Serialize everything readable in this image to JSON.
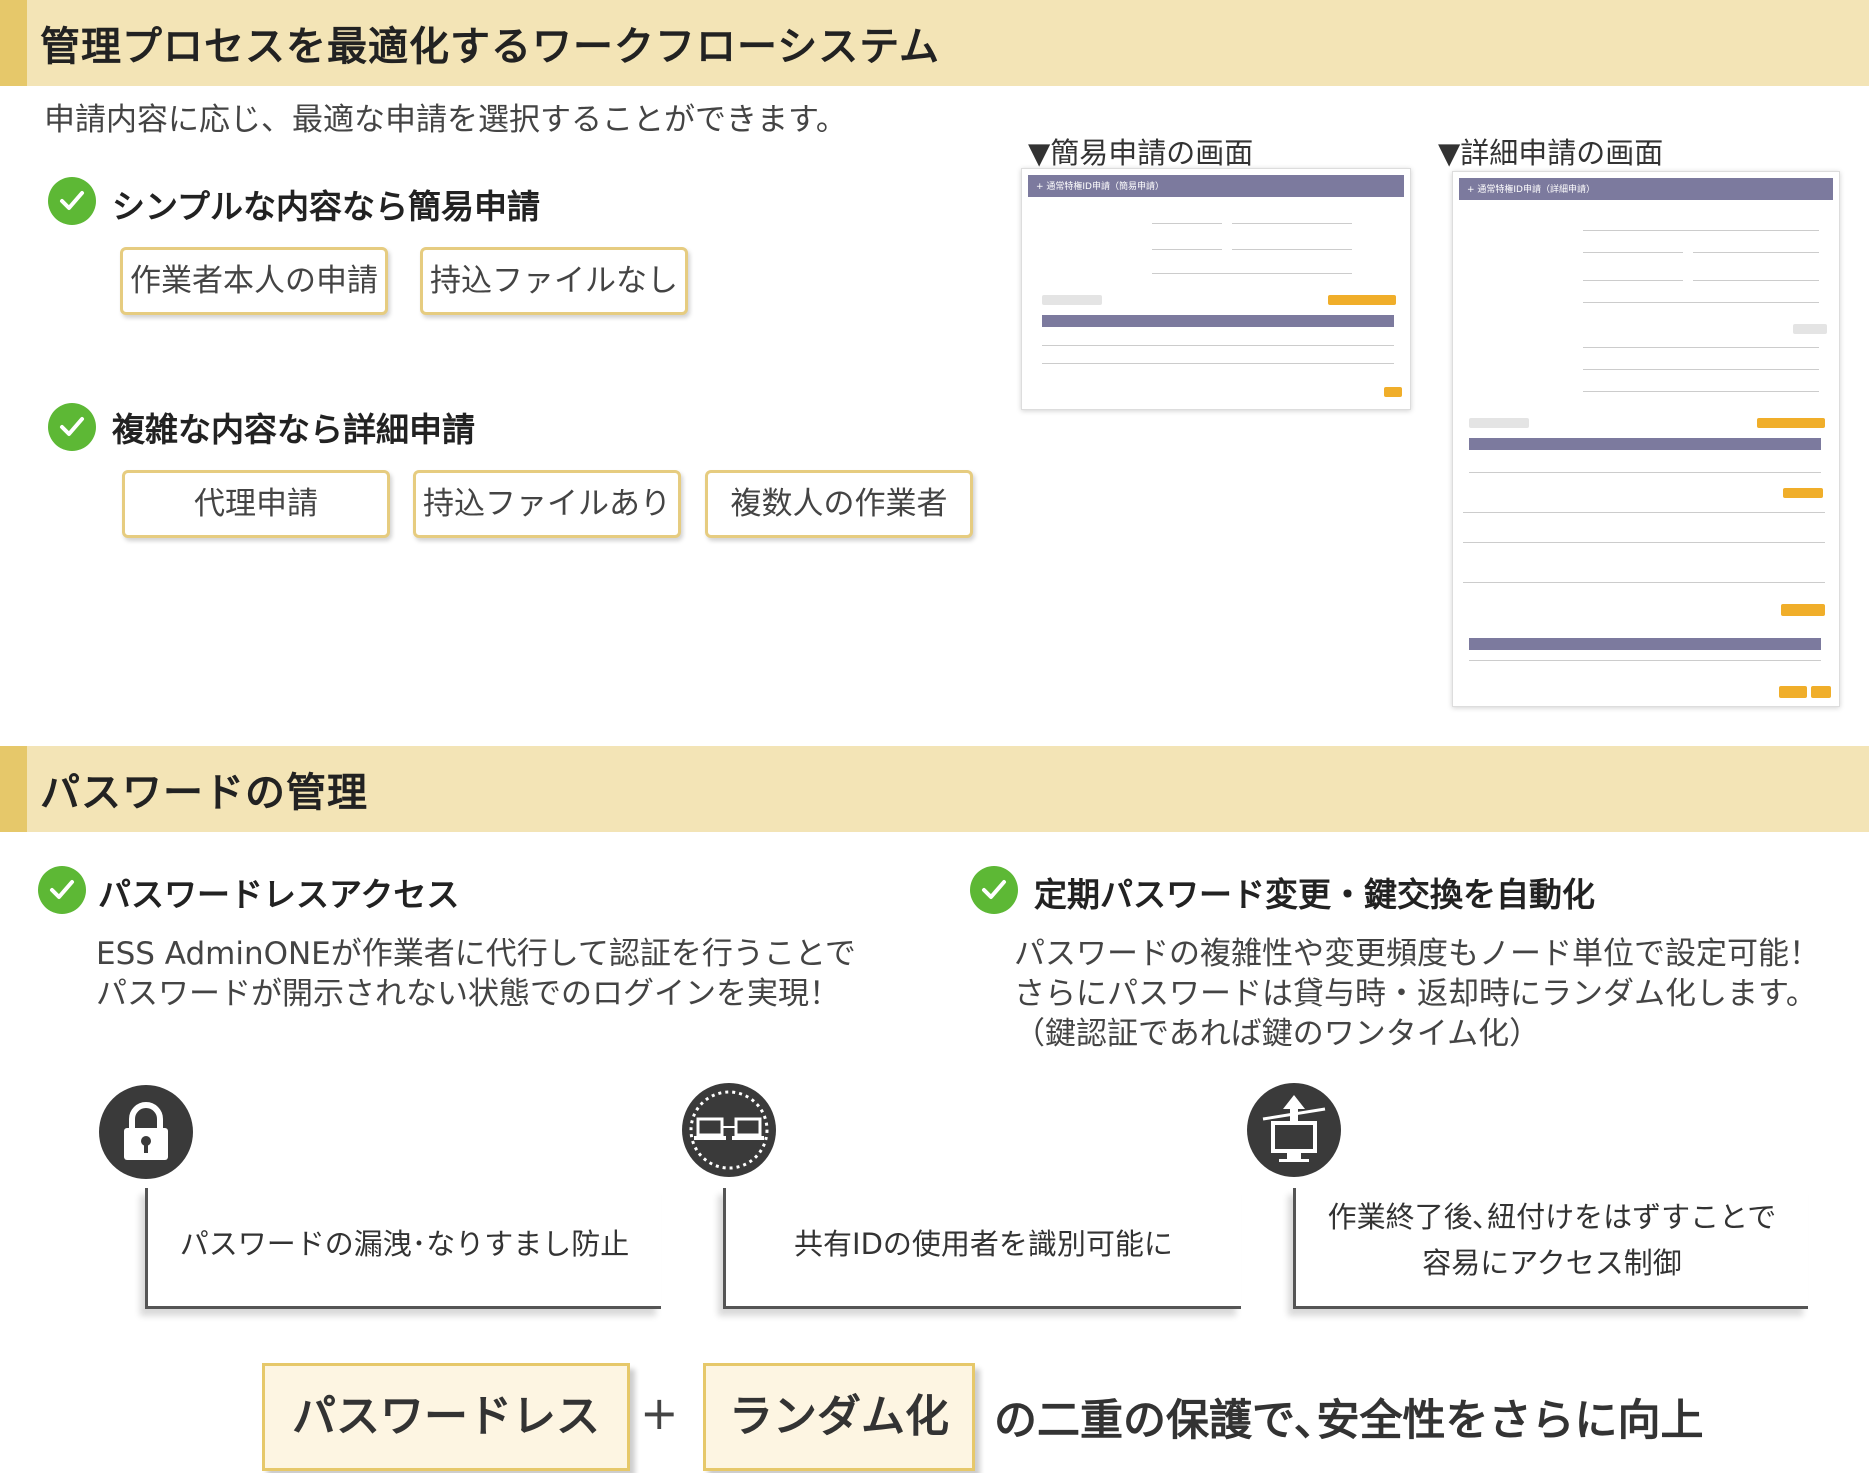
{
  "section1": {
    "title": "管理プロセスを最適化するワークフローシステム",
    "intro": "申請内容に応じ、最適な申請を選択することができます。",
    "simple": {
      "heading": "シンプルな内容なら簡易申請",
      "tags": [
        "作業者本人の申請",
        "持込ファイルなし"
      ]
    },
    "detail": {
      "heading": "複雑な内容なら詳細申請",
      "tags": [
        "代理申請",
        "持込ファイルあり",
        "複数人の作業者"
      ]
    },
    "screens": {
      "simple_caption": "▼簡易申請の画面",
      "detail_caption": "▼詳細申請の画面",
      "simple_header": "+ 通常特権ID申請（簡易申請）",
      "detail_header": "+ 通常特権ID申請（詳細申請）"
    }
  },
  "section2": {
    "title": "パスワードの管理",
    "left": {
      "heading": "パスワードレスアクセス",
      "lines": [
        "ESS AdminONEが作業者に代行して認証を行うことで",
        "パスワードが開示されない状態でのログインを実現！"
      ]
    },
    "right": {
      "heading": "定期パスワード変更・鍵交換を自動化",
      "lines": [
        "パスワードの複雑性や変更頻度もノード単位で設定可能！",
        "さらにパスワードは貸与時・返却時にランダム化します。",
        "（鍵認証であれば鍵のワンタイム化）"
      ]
    },
    "features": [
      {
        "icon": "lock-icon",
        "lines": [
          "パスワードの漏洩･なりすまし防止"
        ]
      },
      {
        "icon": "network-icon",
        "lines": [
          "共有IDの使用者を識別可能に"
        ]
      },
      {
        "icon": "monitor-upload-icon",
        "lines": [
          "作業終了後､紐付けをはずすことで",
          "容易にアクセス制御"
        ]
      }
    ],
    "bottom": {
      "box1": "パスワードレス",
      "plus": "+",
      "box2": "ランダム化",
      "tail": "の二重の保護で､安全性をさらに向上"
    }
  },
  "colors": {
    "section_bg": "#f3e4b6",
    "section_accent": "#e6c86a",
    "check_green": "#5db835",
    "tag_border": "#e6cc80",
    "screen_header": "#7c7a9e",
    "screen_button": "#f0ae2a"
  }
}
